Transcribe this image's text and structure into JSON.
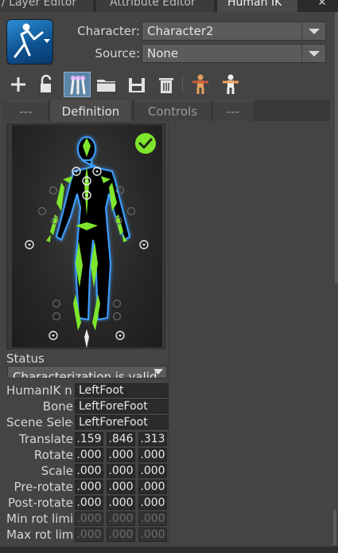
{
  "tabs": {
    "items": [
      "/ Layer Editor",
      "Attribute Editor",
      "Human IK"
    ],
    "active": "Human IK"
  },
  "header": {
    "character_label": "Character:",
    "character_value": "Character2",
    "source_label": "Source:",
    "source_value": "None"
  },
  "toolbar": {
    "icons": [
      "plus-icon",
      "lock-icon",
      "bones-icon",
      "folder-icon",
      "save-icon",
      "trash-icon",
      "skeleton-icon",
      "tpose-icon"
    ],
    "active": "bones-icon"
  },
  "subtabs": {
    "items": [
      "---",
      "Definition",
      "Controls",
      "---"
    ],
    "active": "Definition"
  },
  "figure": {
    "valid_icon": "check-circle-icon"
  },
  "status": {
    "label": "Status",
    "value": "Characterization is valid"
  },
  "properties": {
    "humanik_name": {
      "label": "HumanIK n",
      "value": "LeftFoot"
    },
    "bone": {
      "label": "Bone",
      "value": "LeftForeFoot"
    },
    "scene_selected": {
      "label": "Scene Selec",
      "value": "LeftForeFoot"
    },
    "translate": {
      "label": "Translate",
      "values": [
        ".159",
        ".846",
        ".313"
      ]
    },
    "rotate": {
      "label": "Rotate",
      "values": [
        ".000",
        ".000",
        ".000"
      ]
    },
    "scale": {
      "label": "Scale",
      "values": [
        ".000",
        ".000",
        ".000"
      ]
    },
    "pre_rotate": {
      "label": "Pre-rotate",
      "values": [
        ".000",
        ".000",
        ".000"
      ]
    },
    "post_rotate": {
      "label": "Post-rotate",
      "values": [
        ".000",
        ".000",
        ".000"
      ]
    },
    "min_rot_limit": {
      "label": "Min rot limi",
      "values": [
        ".000",
        ".000",
        ".000"
      ]
    },
    "max_rot_limit": {
      "label": "Max rot lim",
      "values": [
        ".000",
        ".000",
        ".000"
      ]
    }
  },
  "colors": {
    "accent_green": "#7ee52c",
    "panel_bg": "#444444",
    "active_tool": "#5c86a8",
    "outline_blue": "#4aa8ff"
  }
}
